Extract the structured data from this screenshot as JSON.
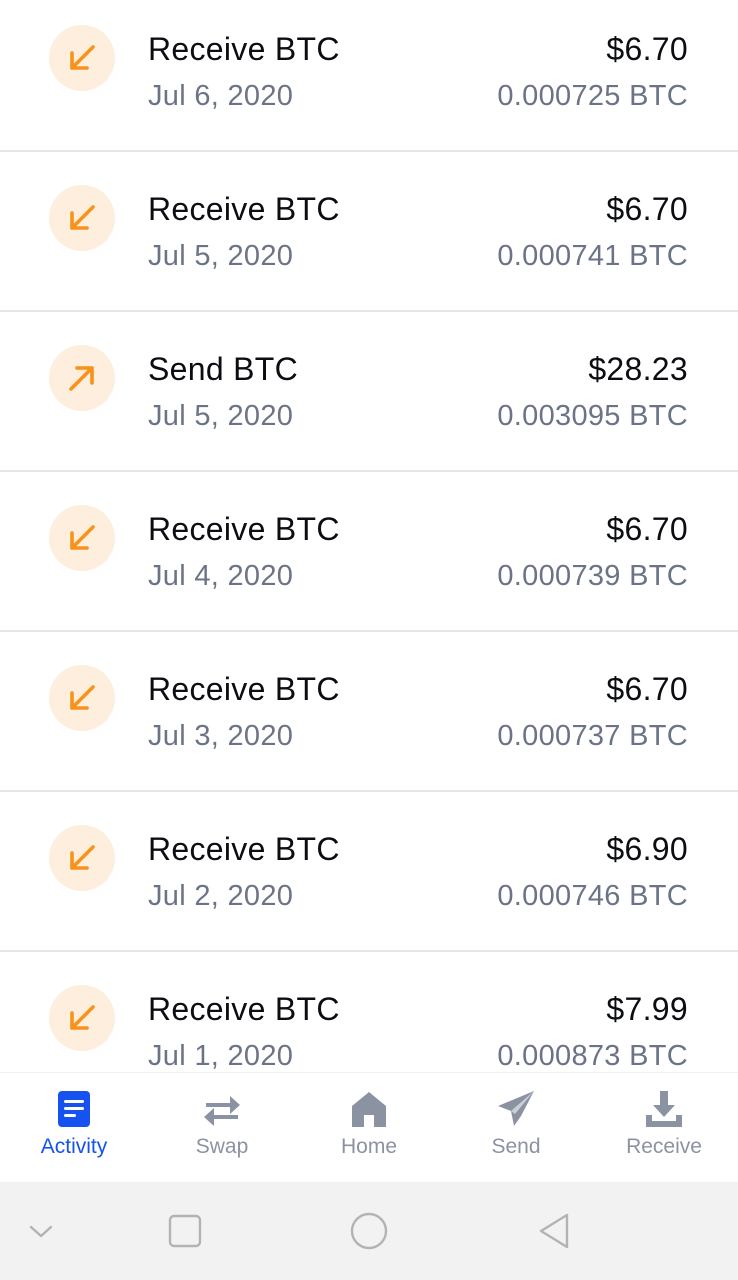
{
  "transactions": [
    {
      "title": "Receive BTC",
      "date": "Jul 6, 2020",
      "fiat": "$6.70",
      "crypto": "0.000725 BTC",
      "direction": "receive"
    },
    {
      "title": "Receive BTC",
      "date": "Jul 5, 2020",
      "fiat": "$6.70",
      "crypto": "0.000741 BTC",
      "direction": "receive"
    },
    {
      "title": "Send BTC",
      "date": "Jul 5, 2020",
      "fiat": "$28.23",
      "crypto": "0.003095 BTC",
      "direction": "send"
    },
    {
      "title": "Receive BTC",
      "date": "Jul 4, 2020",
      "fiat": "$6.70",
      "crypto": "0.000739 BTC",
      "direction": "receive"
    },
    {
      "title": "Receive BTC",
      "date": "Jul 3, 2020",
      "fiat": "$6.70",
      "crypto": "0.000737 BTC",
      "direction": "receive"
    },
    {
      "title": "Receive BTC",
      "date": "Jul 2, 2020",
      "fiat": "$6.90",
      "crypto": "0.000746 BTC",
      "direction": "receive"
    },
    {
      "title": "Receive BTC",
      "date": "Jul 1, 2020",
      "fiat": "$7.99",
      "crypto": "0.000873 BTC",
      "direction": "receive"
    }
  ],
  "tabbar": {
    "activity": "Activity",
    "swap": "Swap",
    "home": "Home",
    "send": "Send",
    "receive": "Receive",
    "active": "activity"
  },
  "colors": {
    "accent": "#1652f0",
    "icon_orange": "#f7931a",
    "icon_bg": "#fdeedd",
    "muted": "#8b93a3"
  }
}
